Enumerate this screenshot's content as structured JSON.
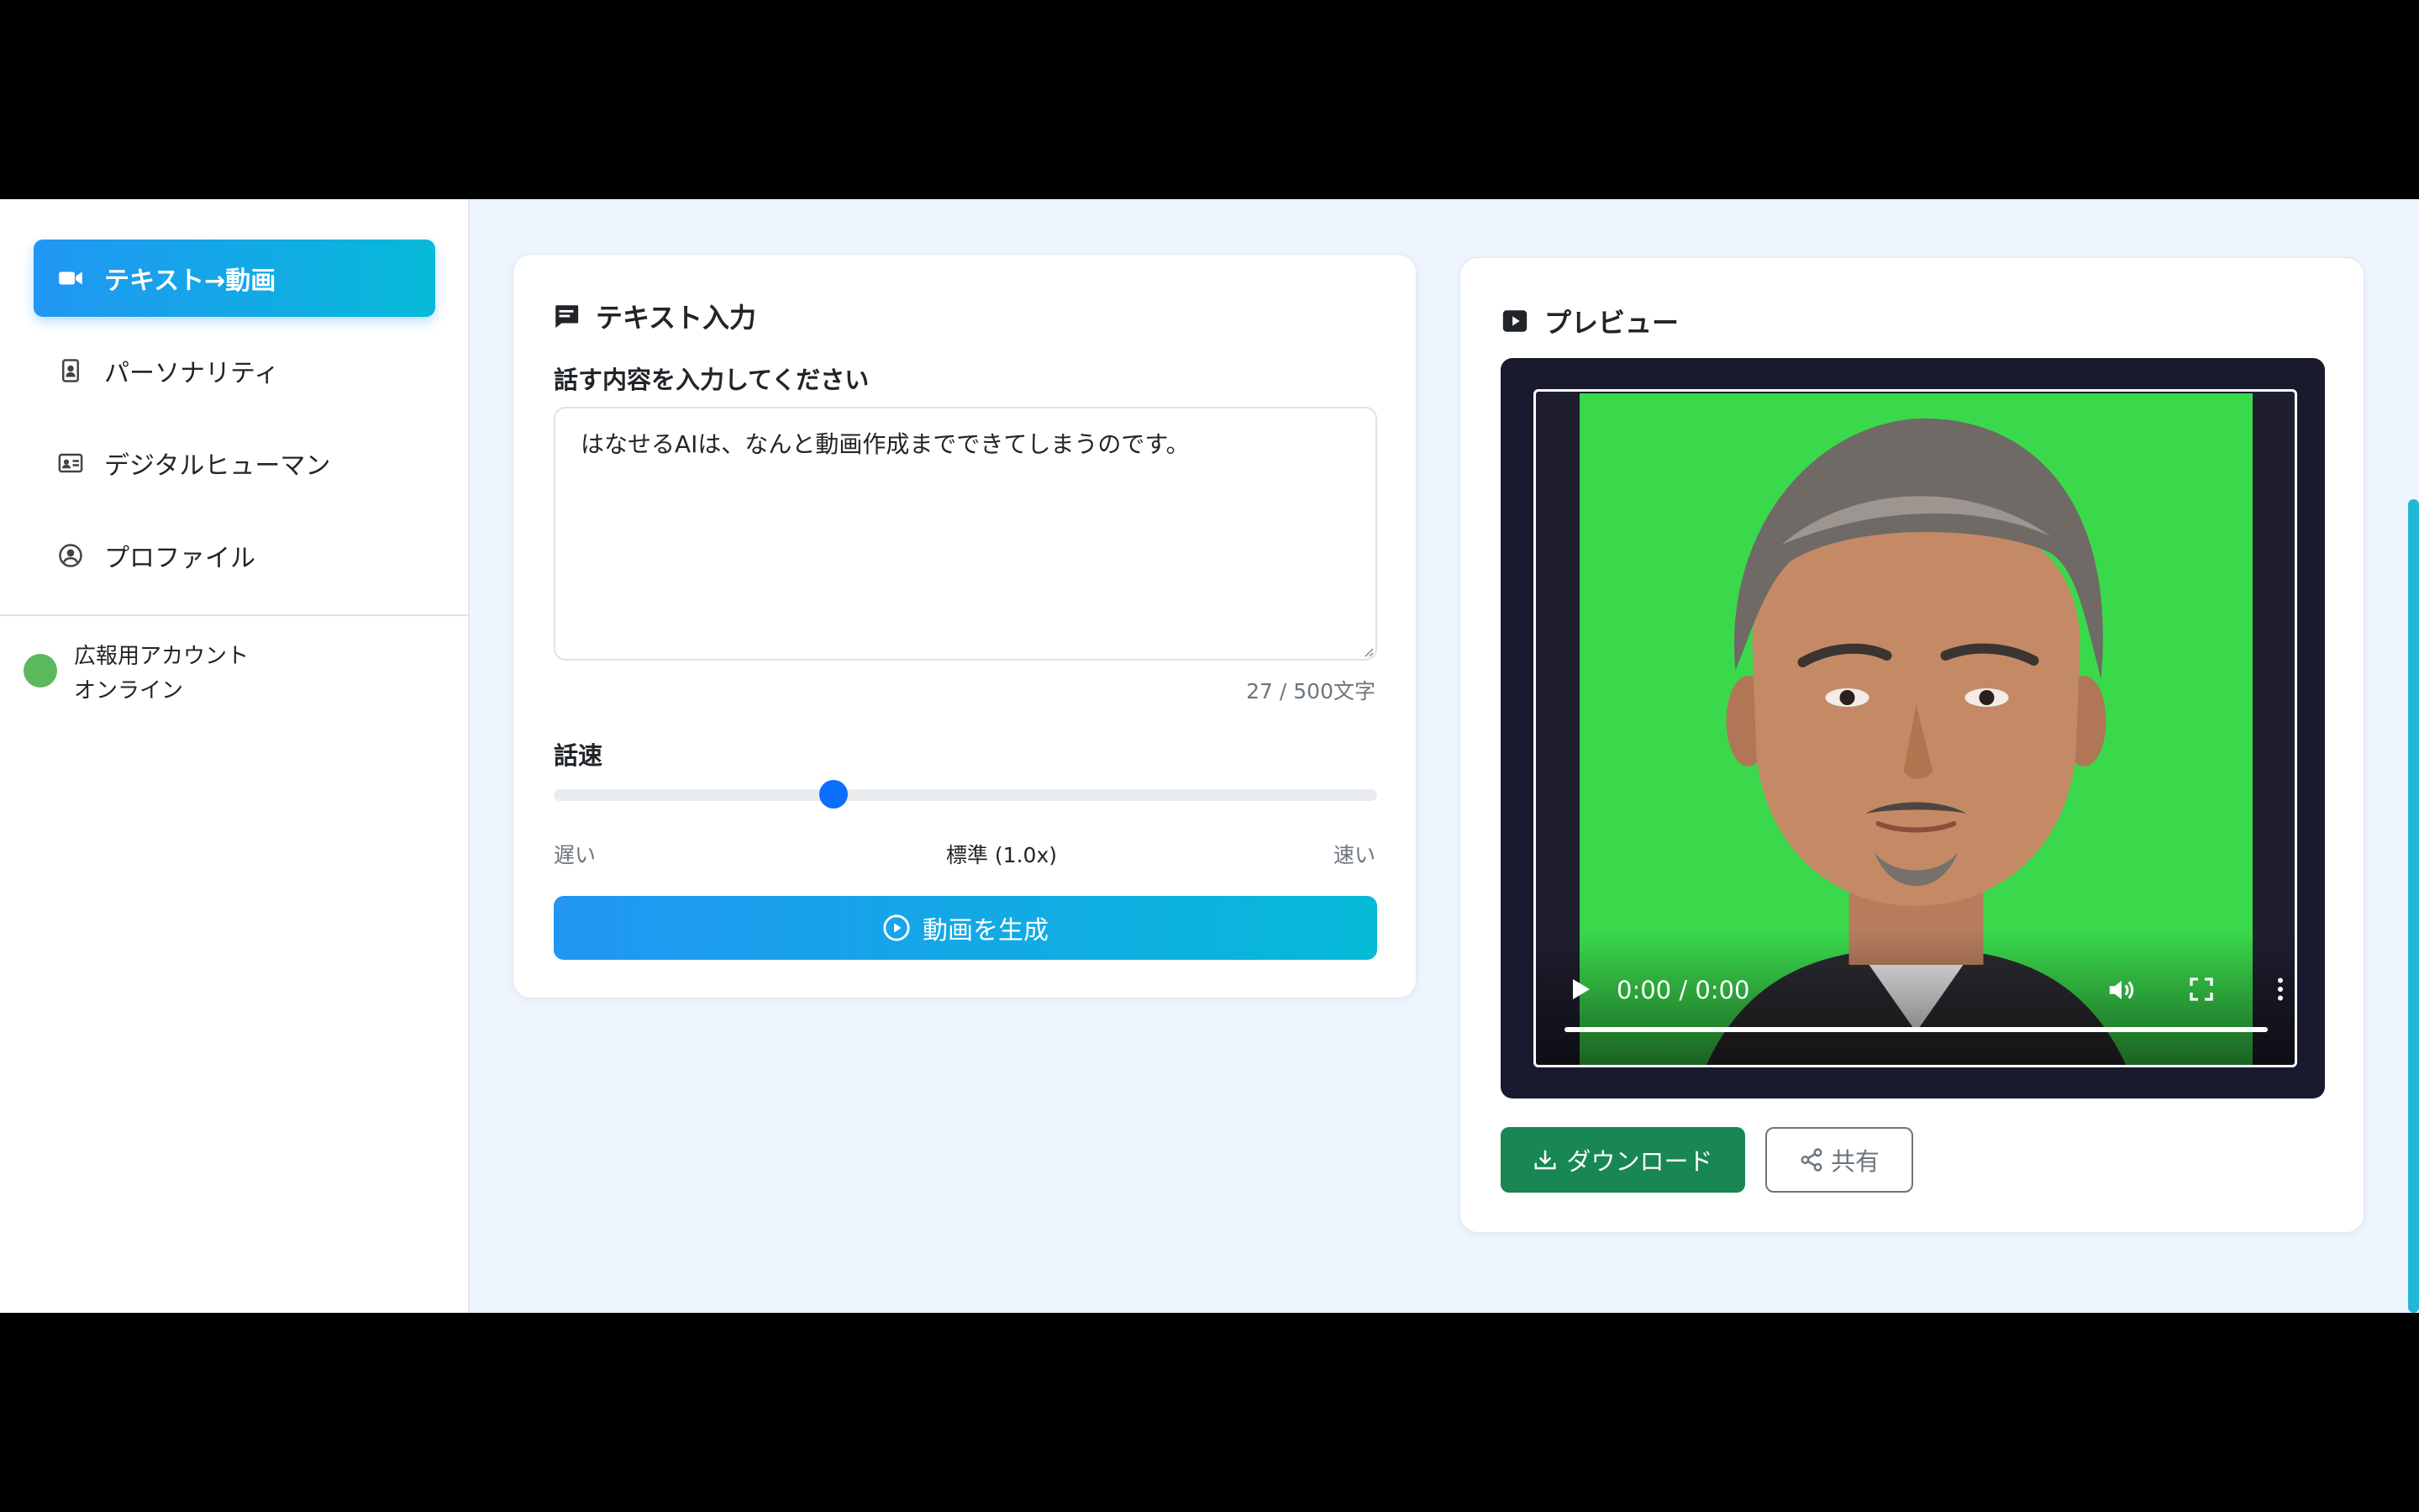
{
  "sidebar": {
    "items": [
      {
        "label": "テキスト→動画",
        "icon": "video-camera-icon",
        "active": true
      },
      {
        "label": "パーソナリティ",
        "icon": "id-badge-icon",
        "active": false
      },
      {
        "label": "デジタルヒューマン",
        "icon": "id-card-icon",
        "active": false
      },
      {
        "label": "プロファイル",
        "icon": "user-circle-icon",
        "active": false
      }
    ],
    "account": {
      "name": "広報用アカウント",
      "status": "オンライン",
      "status_color": "#5cb85c"
    }
  },
  "input_card": {
    "title": "テキスト入力",
    "text_label": "話す内容を入力してください",
    "text_value": "はなせるAIは、なんと動画作成までできてしまうのです。",
    "char_count": "27 / 500文字",
    "speed_label": "話速",
    "speed_value_fraction": 0.34,
    "speed_min_label": "遅い",
    "speed_current_label": "標準 (1.0x)",
    "speed_max_label": "速い",
    "generate_label": "動画を生成"
  },
  "preview_card": {
    "title": "プレビュー",
    "video_time": "0:00 / 0:00",
    "download_label": "ダウンロード",
    "share_label": "共有"
  },
  "colors": {
    "accent_gradient_start": "#2196f3",
    "accent_gradient_end": "#06bad8",
    "download_green": "#198754",
    "slider_thumb": "#0d6efd",
    "video_background": "#3ad94c"
  }
}
